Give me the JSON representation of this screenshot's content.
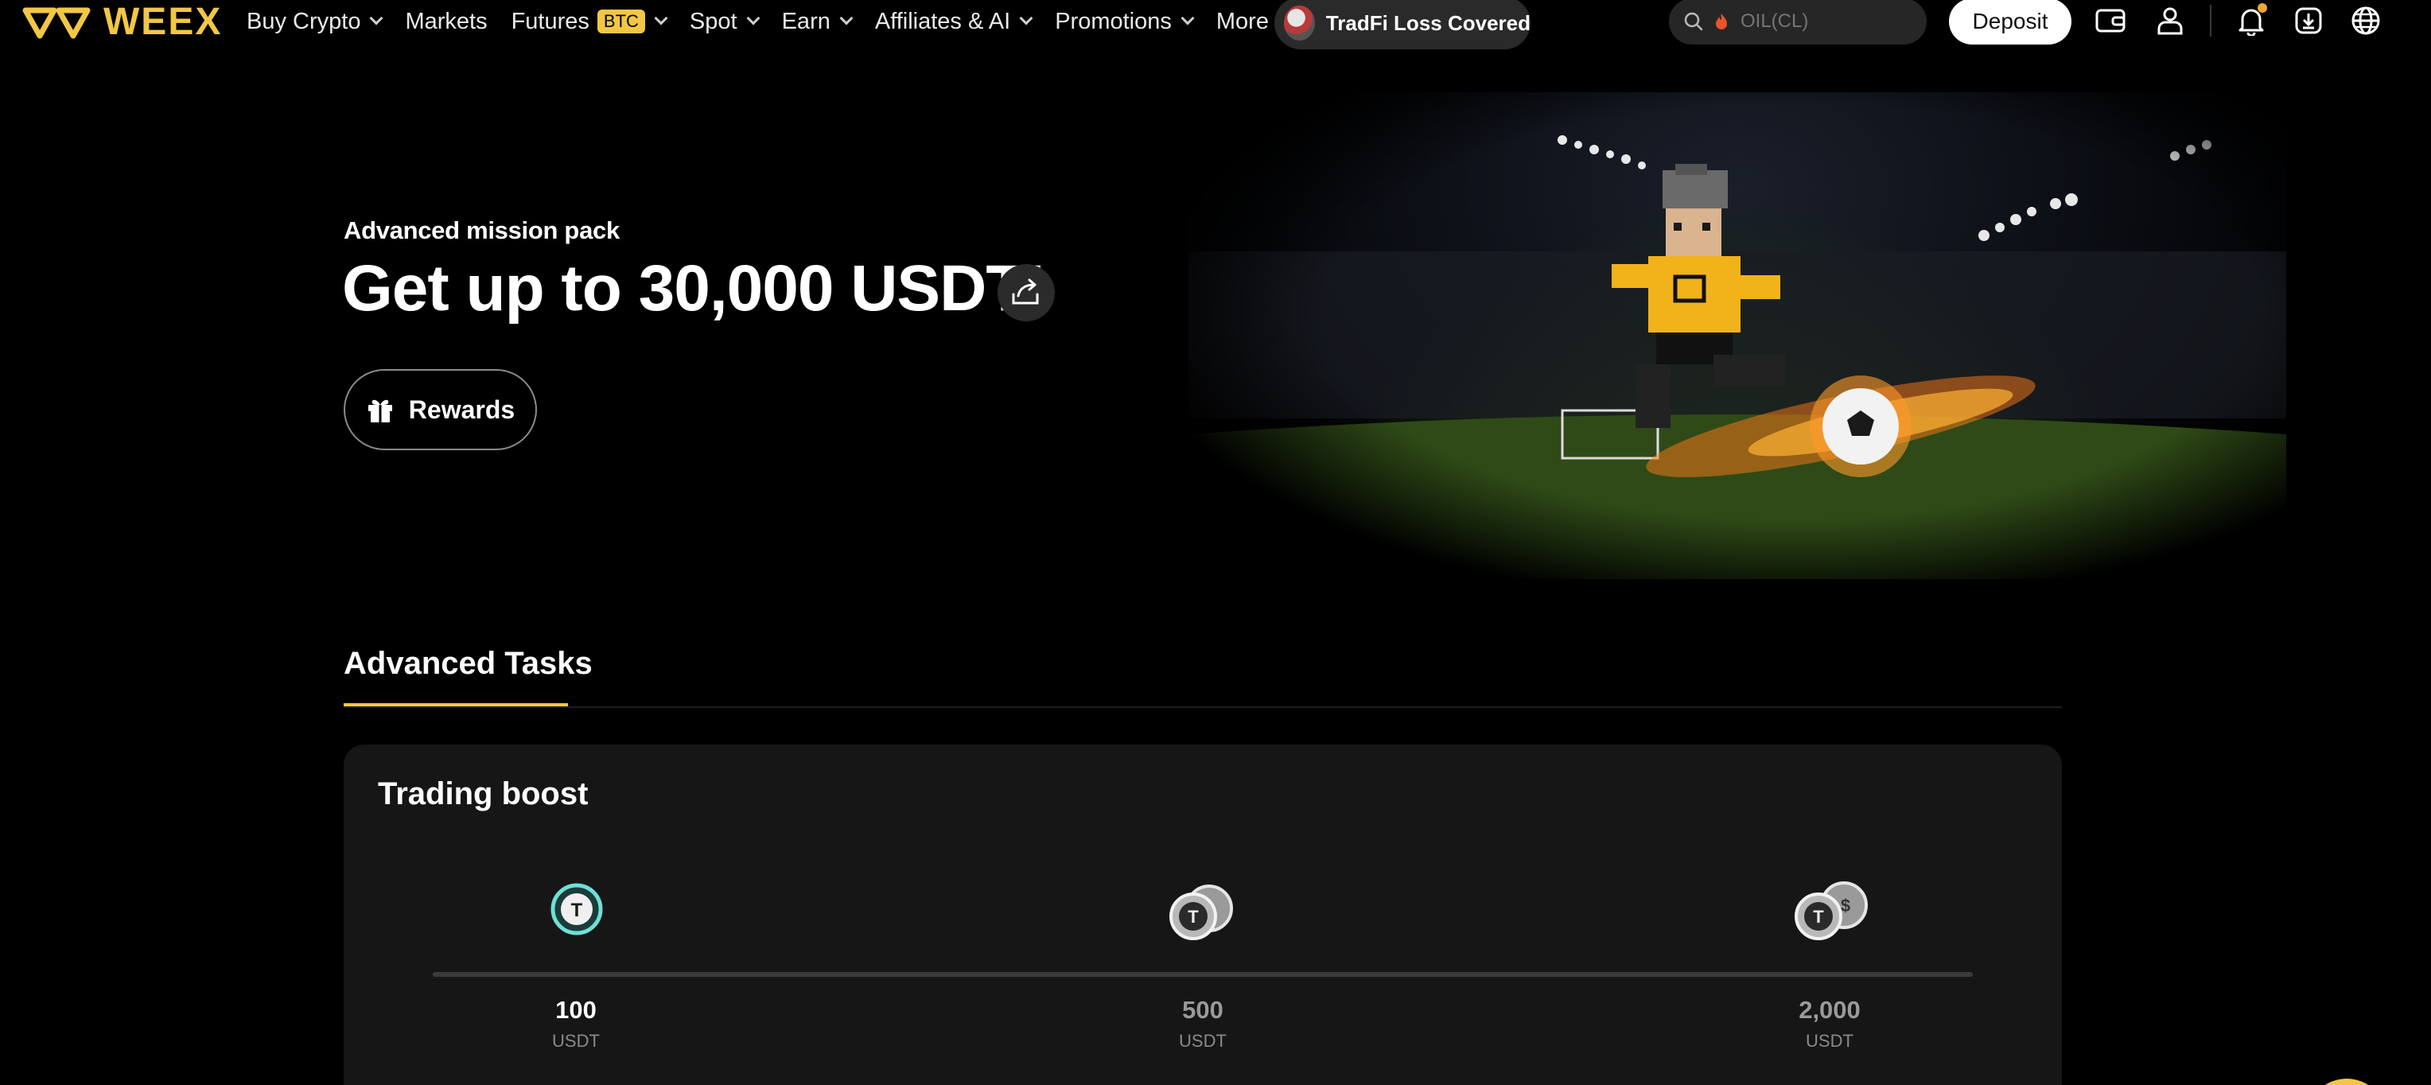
{
  "brand": {
    "name": "WEEX",
    "color": "#f2c744"
  },
  "nav": {
    "items": [
      {
        "label": "Buy Crypto",
        "dropdown": true
      },
      {
        "label": "Markets",
        "dropdown": false
      },
      {
        "label": "Futures",
        "badge": "BTC",
        "dropdown": true
      },
      {
        "label": "Spot",
        "dropdown": true
      },
      {
        "label": "Earn",
        "dropdown": true
      },
      {
        "label": "Affiliates & AI",
        "dropdown": true
      },
      {
        "label": "Promotions",
        "dropdown": true
      },
      {
        "label": "More",
        "dropdown": true
      }
    ],
    "promo_pill": "TradFi Loss Covered",
    "search_placeholder": "OIL(CL)",
    "deposit_label": "Deposit",
    "icons": [
      "wallet-icon",
      "user-icon",
      "bell-icon",
      "download-icon",
      "globe-icon"
    ]
  },
  "hero": {
    "subtitle": "Advanced mission pack",
    "title": "Get up to 30,000 USDT!",
    "rewards_label": "Rewards"
  },
  "tabs": [
    {
      "label": "Advanced Tasks",
      "active": true
    }
  ],
  "card": {
    "title": "Trading boost",
    "milestones": [
      {
        "amount": "100",
        "unit": "USDT",
        "active": true
      },
      {
        "amount": "500",
        "unit": "USDT",
        "active": false
      },
      {
        "amount": "2,000",
        "unit": "USDT",
        "active": false
      }
    ]
  }
}
